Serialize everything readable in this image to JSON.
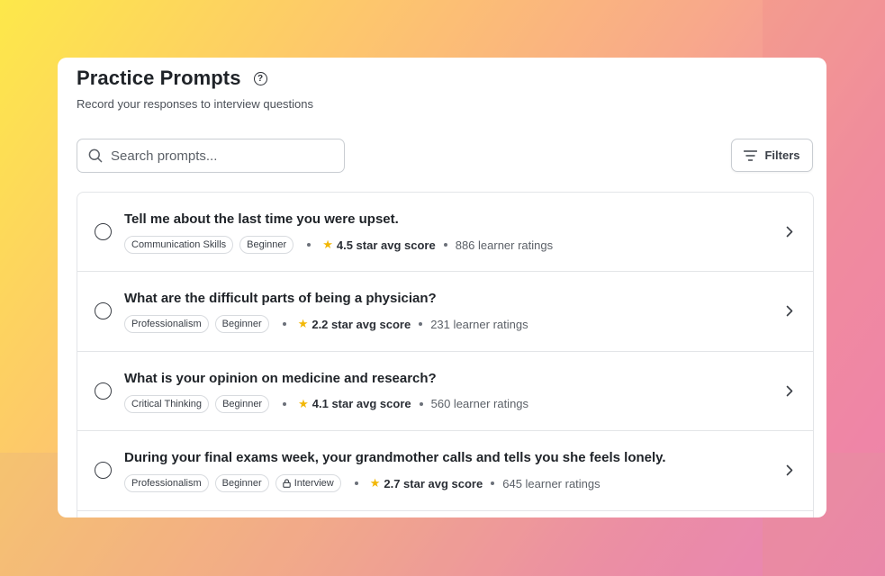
{
  "page": {
    "title": "Practice Prompts",
    "subtitle": "Record your responses to interview questions"
  },
  "search": {
    "placeholder": "Search prompts...",
    "value": ""
  },
  "filters": {
    "label": "Filters"
  },
  "prompts": [
    {
      "question": "Tell me about the last time you were upset.",
      "tags": [
        "Communication Skills",
        "Beginner"
      ],
      "score": "4.5 star avg score",
      "ratings": "886 learner ratings"
    },
    {
      "question": "What are the difficult parts of being a physician?",
      "tags": [
        "Professionalism",
        "Beginner"
      ],
      "score": "2.2 star avg score",
      "ratings": "231 learner ratings"
    },
    {
      "question": "What is your opinion on medicine and research?",
      "tags": [
        "Critical Thinking",
        "Beginner"
      ],
      "score": "4.1 star avg score",
      "ratings": "560 learner ratings"
    },
    {
      "question": "During your final exams week, your grandmother calls and tells you she feels lonely.",
      "tags": [
        "Professionalism",
        "Beginner",
        "Interview"
      ],
      "score": "2.7 star avg score",
      "ratings": "645 learner ratings"
    }
  ],
  "icons": {
    "help": "question-circle-icon",
    "search": "search-icon",
    "filter": "filter-lines-icon",
    "star": "star-icon",
    "chevron": "chevron-right-icon",
    "lock": "lock-icon"
  },
  "colors": {
    "star": "#f2b705",
    "text": "#1f2328",
    "border": "#e3e5e8"
  }
}
